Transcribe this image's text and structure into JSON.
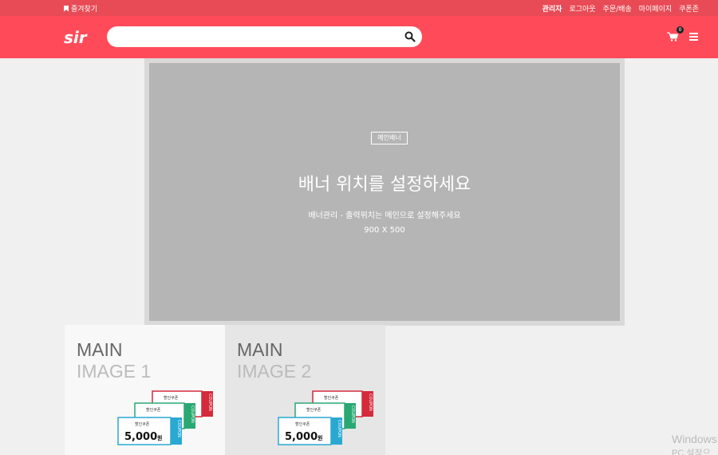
{
  "topbar": {
    "bookmark_label": "즐겨찾기",
    "links": [
      "관리자",
      "로그아웃",
      "주문/배송",
      "마이페이지",
      "쿠폰존"
    ]
  },
  "header": {
    "logo_text": "sir",
    "search": {
      "placeholder": "",
      "value": ""
    },
    "cart_count": "0"
  },
  "banner": {
    "tag": "메인배너",
    "headline": "배너 위치를 설정하세요",
    "description": "배너관리 - 출력위치는 메인으로 설정해주세요",
    "size": "900 X 500"
  },
  "tiles": [
    {
      "line1": "MAIN",
      "line2": "IMAGE 1"
    },
    {
      "line1": "MAIN",
      "line2": "IMAGE 2"
    }
  ],
  "coupon": {
    "label": "할인쿠폰",
    "amount": "5,000",
    "unit": "원",
    "side_text": "COUPON"
  },
  "colors": {
    "topbar": "#e84b56",
    "header": "#ff4b59",
    "banner": "#b5b5b5",
    "coupon_red": "#d42a3c",
    "coupon_green": "#2aa872",
    "coupon_blue": "#29a9d2"
  },
  "watermark": {
    "line1": "Windows",
    "line2": "PC 설정으로"
  }
}
